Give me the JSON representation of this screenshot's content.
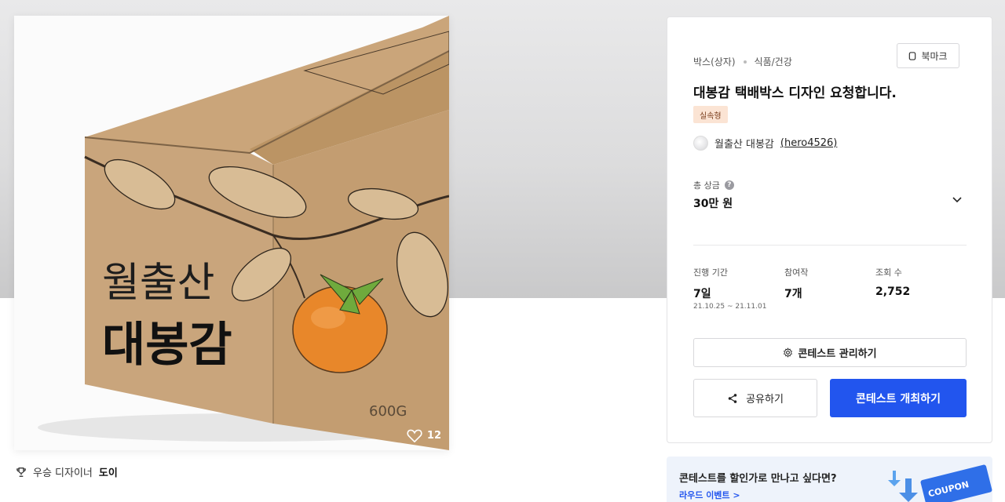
{
  "image": {
    "box_brand_line1": "월출산",
    "box_brand_line2": "대봉감",
    "box_weight": "600G",
    "like_count": "12"
  },
  "winner": {
    "label": "우승 디자이너",
    "name": "도이"
  },
  "panel": {
    "category_main": "박스(상자)",
    "category_sub": "식품/건강",
    "bookmark_label": "북마크",
    "title": "대봉감 택배박스 디자인 요청합니다.",
    "tag": "실속형",
    "host_name": "월출산 대봉감",
    "host_id": "(hero4526)",
    "prize_label": "총 상금",
    "prize_amount": "30만 원",
    "stats": {
      "duration_label": "진행 기간",
      "duration_value": "7일",
      "duration_range": "21.10.25 ~ 21.11.01",
      "entries_label": "참여작",
      "entries_value": "7개",
      "views_label": "조회 수",
      "views_value": "2,752"
    },
    "manage_button": "콘테스트 관리하기",
    "share_button": "공유하기",
    "host_button": "콘테스트 개최하기"
  },
  "coupon": {
    "question": "콘테스트를 할인가로 만나고 싶다면?",
    "link": "라우드 이벤트 >",
    "ticket_text": "COUPON"
  },
  "colors": {
    "primary": "#2255ee",
    "tag_bg": "#fbe4d4",
    "coupon_bg": "#eef3fb"
  }
}
